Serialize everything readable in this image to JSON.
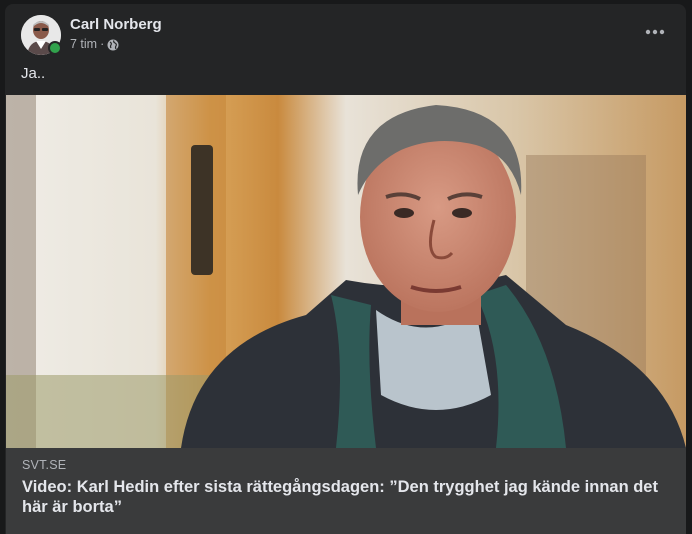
{
  "post": {
    "author": "Carl Norberg",
    "time": "7 tim",
    "separator": "·",
    "privacy_icon": "globe-icon",
    "more_icon": "more-dots-icon",
    "caption": "Ja..",
    "online": true
  },
  "link": {
    "domain": "SVT.SE",
    "title": "Video: Karl Hedin efter sista rättegångsdagen: ”Den trygghet jag kände innan det här är borta”"
  },
  "colors": {
    "background": "#18191a",
    "card": "#242526",
    "link_info": "#3a3b3c",
    "primary_text": "#e4e6eb",
    "secondary_text": "#b0b3b8",
    "online": "#31a24c"
  }
}
